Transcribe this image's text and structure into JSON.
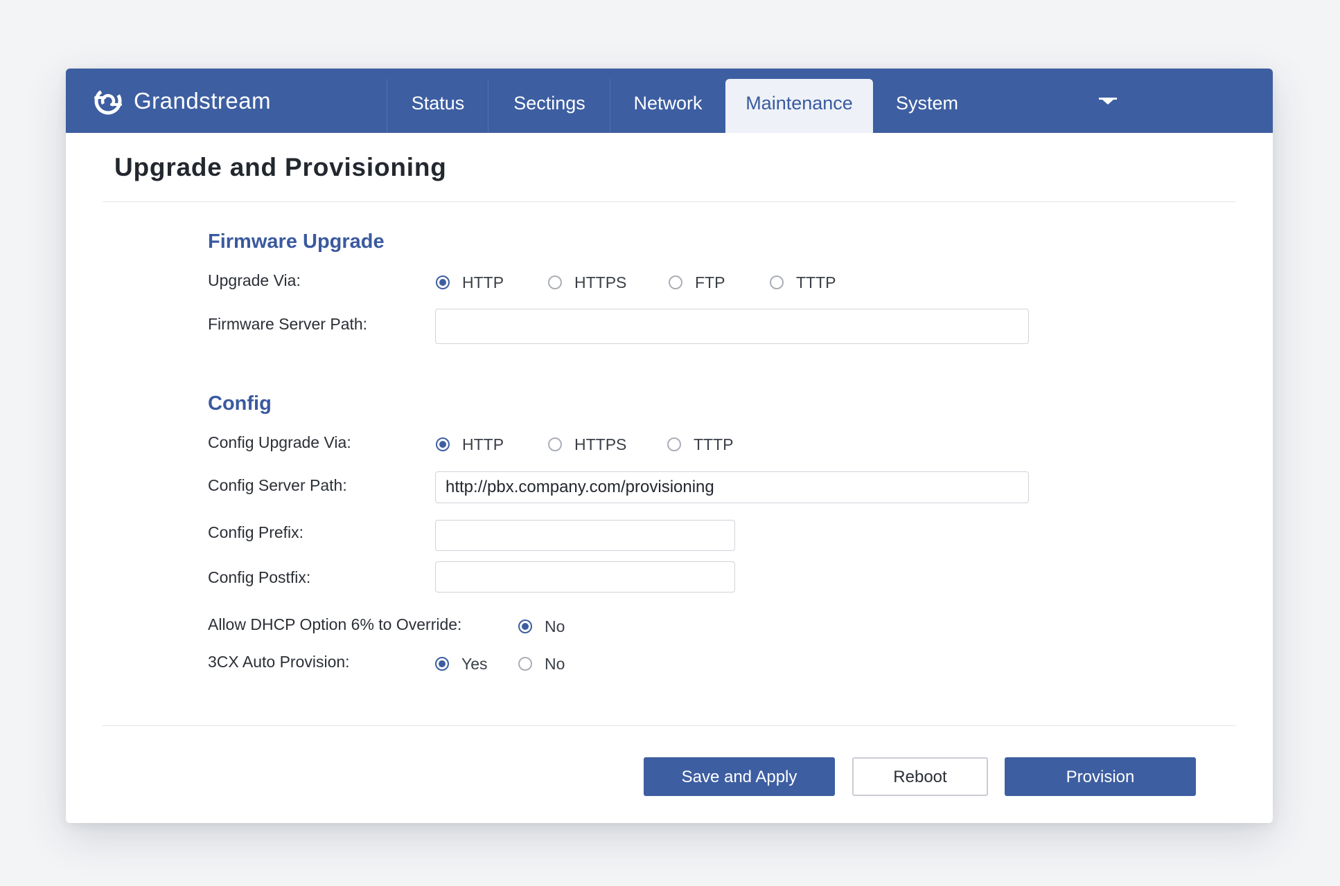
{
  "brand": {
    "name": "Grandstream"
  },
  "nav": {
    "tabs": [
      {
        "label": "Status"
      },
      {
        "label": "Sectings"
      },
      {
        "label": "Network"
      },
      {
        "label": "Maintenance",
        "active": true
      },
      {
        "label": "System"
      }
    ],
    "dropdown_icon": "caret-down-icon"
  },
  "page": {
    "title": "Upgrade and Provisioning"
  },
  "firmware": {
    "title": "Firmware Upgrade",
    "upgrade_via_label": "Upgrade Via:",
    "upgrade_via_options": [
      "HTTP",
      "HTTPS",
      "FTP",
      "TTTP"
    ],
    "upgrade_via_selected": "HTTP",
    "server_path_label": "Firmware Server Path:",
    "server_path_value": ""
  },
  "config": {
    "title": "Config",
    "upgrade_via_label": "Config Upgrade Via:",
    "upgrade_via_options": [
      "HTTP",
      "HTTPS",
      "TTTP"
    ],
    "upgrade_via_selected": "HTTP",
    "server_path_label": "Config Server Path:",
    "server_path_value": "http://pbx.company.com/provisioning",
    "prefix_label": "Config Prefix:",
    "prefix_value": "",
    "postfix_label": "Config Postfix:",
    "postfix_value": "",
    "dhcp_label": "Allow DHCP Option 6% to Override:",
    "dhcp_option": "No",
    "dhcp_selected": "No",
    "auto_provision_label": "3CX Auto Provision:",
    "auto_provision_options": [
      "Yes",
      "No"
    ],
    "auto_provision_selected": "Yes"
  },
  "actions": {
    "save_label": "Save and Apply",
    "reboot_label": "Reboot",
    "provision_label": "Provision"
  },
  "colors": {
    "brand": "#3d5ea1",
    "active_tab_bg": "#eef2f8",
    "section_title": "#3a5a9f"
  }
}
